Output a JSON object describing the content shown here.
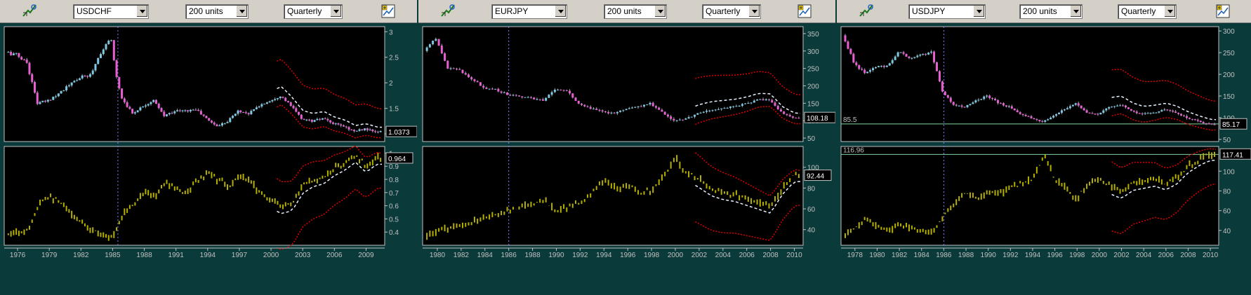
{
  "colors": {
    "accent": "#c0c0c0",
    "price_up": "#7ec8e3",
    "price_down": "#e75fd1",
    "volume": "#b5b000",
    "band": "#e00000",
    "trend": "#e6f2ff",
    "hline": "#7fd6a0"
  },
  "panels": [
    {
      "symbol": "USDCHF",
      "units": "200 units",
      "period": "Quarterly",
      "price_label": "1.0373",
      "osc_label": "0.964",
      "x_ticks": [
        "1976",
        "1979",
        "1982",
        "1985",
        "1988",
        "1991",
        "1994",
        "1997",
        "2000",
        "2003",
        "2006",
        "2009"
      ],
      "price_ticks": [
        "3",
        "2.5",
        "2",
        "1.5",
        "1"
      ],
      "osc_ticks": [
        "1",
        "0.9",
        "0.8",
        "0.7",
        "0.6",
        "0.5",
        "0.4"
      ]
    },
    {
      "symbol": "EURJPY",
      "units": "200 units",
      "period": "Quarterly",
      "price_label": "108.18",
      "osc_label": "92.44",
      "x_ticks": [
        "1980",
        "1982",
        "1984",
        "1986",
        "1988",
        "1990",
        "1992",
        "1994",
        "1996",
        "1998",
        "2000",
        "2002",
        "2004",
        "2006",
        "2008",
        "2010"
      ],
      "price_ticks": [
        "350",
        "300",
        "250",
        "200",
        "150",
        "100",
        "50"
      ],
      "osc_ticks": [
        "100",
        "80",
        "60",
        "40"
      ]
    },
    {
      "symbol": "USDJPY",
      "units": "200 units",
      "period": "Quarterly",
      "price_label": "85.17",
      "osc_label": "117.41",
      "hline_price_label": "85.5",
      "hline_osc_label": "116.96",
      "x_ticks": [
        "1978",
        "1980",
        "1982",
        "1984",
        "1986",
        "1988",
        "1990",
        "1992",
        "1994",
        "1996",
        "1998",
        "2000",
        "2002",
        "2004",
        "2006",
        "2008",
        "2010"
      ],
      "price_ticks": [
        "300",
        "250",
        "200",
        "150",
        "100",
        "50"
      ],
      "osc_ticks": [
        "100",
        "80",
        "60",
        "40"
      ]
    }
  ],
  "chart_data": [
    {
      "type": "line",
      "title": "USDCHF",
      "x_range": [
        1975,
        2010.5
      ],
      "price": {
        "ylim": [
          0.85,
          3.1
        ],
        "points": [
          [
            1975,
            2.6
          ],
          [
            1976,
            2.55
          ],
          [
            1977,
            2.4
          ],
          [
            1978,
            1.6
          ],
          [
            1979,
            1.65
          ],
          [
            1980,
            1.8
          ],
          [
            1981,
            1.95
          ],
          [
            1982,
            2.1
          ],
          [
            1983,
            2.15
          ],
          [
            1984,
            2.6
          ],
          [
            1985,
            2.85
          ],
          [
            1985.5,
            2.1
          ],
          [
            1986,
            1.7
          ],
          [
            1987,
            1.4
          ],
          [
            1988,
            1.55
          ],
          [
            1989,
            1.65
          ],
          [
            1990,
            1.35
          ],
          [
            1991,
            1.45
          ],
          [
            1992,
            1.45
          ],
          [
            1993,
            1.48
          ],
          [
            1994,
            1.3
          ],
          [
            1995,
            1.15
          ],
          [
            1996,
            1.25
          ],
          [
            1997,
            1.45
          ],
          [
            1998,
            1.4
          ],
          [
            1999,
            1.55
          ],
          [
            2000,
            1.65
          ],
          [
            2001,
            1.75
          ],
          [
            2002,
            1.55
          ],
          [
            2003,
            1.3
          ],
          [
            2004,
            1.25
          ],
          [
            2005,
            1.3
          ],
          [
            2006,
            1.2
          ],
          [
            2007,
            1.15
          ],
          [
            2008,
            1.05
          ],
          [
            2009,
            1.1
          ],
          [
            2010,
            1.04
          ]
        ]
      },
      "osc": {
        "ylim": [
          0.3,
          1.05
        ],
        "points": [
          [
            1975,
            0.38
          ],
          [
            1976,
            0.4
          ],
          [
            1977,
            0.42
          ],
          [
            1978,
            0.62
          ],
          [
            1979,
            0.68
          ],
          [
            1980,
            0.62
          ],
          [
            1981,
            0.55
          ],
          [
            1982,
            0.48
          ],
          [
            1983,
            0.42
          ],
          [
            1984,
            0.38
          ],
          [
            1985,
            0.35
          ],
          [
            1986,
            0.55
          ],
          [
            1987,
            0.62
          ],
          [
            1988,
            0.7
          ],
          [
            1989,
            0.66
          ],
          [
            1990,
            0.78
          ],
          [
            1991,
            0.72
          ],
          [
            1992,
            0.7
          ],
          [
            1993,
            0.78
          ],
          [
            1994,
            0.85
          ],
          [
            1995,
            0.8
          ],
          [
            1996,
            0.74
          ],
          [
            1997,
            0.82
          ],
          [
            1998,
            0.78
          ],
          [
            1999,
            0.7
          ],
          [
            2000,
            0.64
          ],
          [
            2001,
            0.6
          ],
          [
            2002,
            0.62
          ],
          [
            2003,
            0.75
          ],
          [
            2004,
            0.8
          ],
          [
            2005,
            0.82
          ],
          [
            2006,
            0.88
          ],
          [
            2007,
            0.92
          ],
          [
            2008,
            0.98
          ],
          [
            2009,
            0.9
          ],
          [
            2010,
            0.96
          ]
        ]
      }
    },
    {
      "type": "line",
      "title": "EURJPY",
      "x_range": [
        1979,
        2010.5
      ],
      "price": {
        "ylim": [
          40,
          370
        ],
        "points": [
          [
            1979,
            300
          ],
          [
            1980,
            335
          ],
          [
            1981,
            250
          ],
          [
            1982,
            245
          ],
          [
            1983,
            220
          ],
          [
            1984,
            195
          ],
          [
            1985,
            190
          ],
          [
            1986,
            175
          ],
          [
            1987,
            170
          ],
          [
            1988,
            165
          ],
          [
            1989,
            158
          ],
          [
            1990,
            190
          ],
          [
            1991,
            185
          ],
          [
            1992,
            150
          ],
          [
            1993,
            135
          ],
          [
            1994,
            125
          ],
          [
            1995,
            120
          ],
          [
            1996,
            135
          ],
          [
            1997,
            140
          ],
          [
            1998,
            150
          ],
          [
            1999,
            125
          ],
          [
            2000,
            100
          ],
          [
            2001,
            105
          ],
          [
            2002,
            120
          ],
          [
            2003,
            130
          ],
          [
            2004,
            135
          ],
          [
            2005,
            140
          ],
          [
            2006,
            148
          ],
          [
            2007,
            160
          ],
          [
            2008,
            160
          ],
          [
            2009,
            125
          ],
          [
            2010,
            108
          ]
        ]
      },
      "osc": {
        "ylim": [
          25,
          120
        ],
        "points": [
          [
            1979,
            33
          ],
          [
            1980,
            38
          ],
          [
            1981,
            42
          ],
          [
            1982,
            45
          ],
          [
            1983,
            48
          ],
          [
            1984,
            52
          ],
          [
            1985,
            55
          ],
          [
            1986,
            58
          ],
          [
            1987,
            62
          ],
          [
            1988,
            64
          ],
          [
            1989,
            68
          ],
          [
            1990,
            57
          ],
          [
            1991,
            62
          ],
          [
            1992,
            66
          ],
          [
            1993,
            75
          ],
          [
            1994,
            88
          ],
          [
            1995,
            80
          ],
          [
            1996,
            83
          ],
          [
            1997,
            75
          ],
          [
            1998,
            78
          ],
          [
            1999,
            92
          ],
          [
            2000,
            108
          ],
          [
            2001,
            95
          ],
          [
            2002,
            88
          ],
          [
            2003,
            80
          ],
          [
            2004,
            76
          ],
          [
            2005,
            74
          ],
          [
            2006,
            70
          ],
          [
            2007,
            66
          ],
          [
            2008,
            62
          ],
          [
            2009,
            80
          ],
          [
            2010,
            92
          ]
        ]
      }
    },
    {
      "type": "line",
      "title": "USDJPY",
      "x_range": [
        1977,
        2010.5
      ],
      "price": {
        "ylim": [
          45,
          310
        ],
        "points": [
          [
            1977,
            290
          ],
          [
            1978,
            230
          ],
          [
            1979,
            200
          ],
          [
            1980,
            215
          ],
          [
            1981,
            220
          ],
          [
            1982,
            250
          ],
          [
            1983,
            240
          ],
          [
            1984,
            245
          ],
          [
            1985,
            250
          ],
          [
            1986,
            160
          ],
          [
            1987,
            130
          ],
          [
            1988,
            125
          ],
          [
            1989,
            140
          ],
          [
            1990,
            150
          ],
          [
            1991,
            135
          ],
          [
            1992,
            125
          ],
          [
            1993,
            110
          ],
          [
            1994,
            100
          ],
          [
            1995,
            90
          ],
          [
            1996,
            105
          ],
          [
            1997,
            120
          ],
          [
            1998,
            135
          ],
          [
            1999,
            110
          ],
          [
            2000,
            108
          ],
          [
            2001,
            125
          ],
          [
            2002,
            130
          ],
          [
            2003,
            115
          ],
          [
            2004,
            108
          ],
          [
            2005,
            112
          ],
          [
            2006,
            118
          ],
          [
            2007,
            112
          ],
          [
            2008,
            100
          ],
          [
            2009,
            92
          ],
          [
            2010,
            85
          ]
        ]
      },
      "osc": {
        "ylim": [
          25,
          125
        ],
        "points": [
          [
            1977,
            34
          ],
          [
            1978,
            42
          ],
          [
            1979,
            52
          ],
          [
            1980,
            44
          ],
          [
            1981,
            40
          ],
          [
            1982,
            45
          ],
          [
            1983,
            42
          ],
          [
            1984,
            40
          ],
          [
            1985,
            38
          ],
          [
            1986,
            55
          ],
          [
            1987,
            68
          ],
          [
            1988,
            78
          ],
          [
            1989,
            72
          ],
          [
            1990,
            80
          ],
          [
            1991,
            76
          ],
          [
            1992,
            84
          ],
          [
            1993,
            88
          ],
          [
            1994,
            92
          ],
          [
            1995,
            116
          ],
          [
            1996,
            92
          ],
          [
            1997,
            82
          ],
          [
            1998,
            72
          ],
          [
            1999,
            88
          ],
          [
            2000,
            92
          ],
          [
            2001,
            85
          ],
          [
            2002,
            80
          ],
          [
            2003,
            88
          ],
          [
            2004,
            90
          ],
          [
            2005,
            92
          ],
          [
            2006,
            88
          ],
          [
            2007,
            94
          ],
          [
            2008,
            105
          ],
          [
            2009,
            112
          ],
          [
            2010,
            117
          ]
        ]
      }
    }
  ]
}
